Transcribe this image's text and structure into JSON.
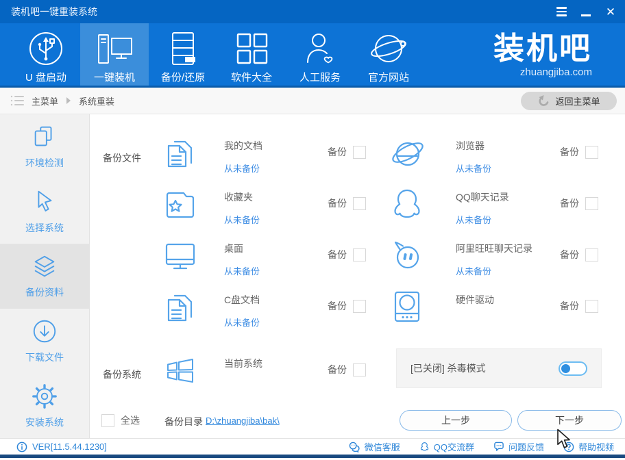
{
  "window": {
    "title": "装机吧一键重装系统"
  },
  "nav": {
    "items": [
      {
        "label": "U 盘启动"
      },
      {
        "label": "一键装机"
      },
      {
        "label": "备份/还原"
      },
      {
        "label": "软件大全"
      },
      {
        "label": "人工服务"
      },
      {
        "label": "官方网站"
      }
    ],
    "logo": {
      "text": "装机吧",
      "url": "zhuangjiba.com"
    }
  },
  "breadcrumb": {
    "root": "主菜单",
    "current": "系统重装",
    "back": "返回主菜单"
  },
  "sidebar": {
    "items": [
      {
        "label": "环境检测"
      },
      {
        "label": "选择系统"
      },
      {
        "label": "备份资料"
      },
      {
        "label": "下载文件"
      },
      {
        "label": "安装系统"
      }
    ]
  },
  "main": {
    "section_files": "备份文件",
    "section_system": "备份系统",
    "backup_label": "备份",
    "items": [
      {
        "title": "我的文档",
        "status": "从未备份"
      },
      {
        "title": "浏览器",
        "status": "从未备份"
      },
      {
        "title": "收藏夹",
        "status": "从未备份"
      },
      {
        "title": "QQ聊天记录",
        "status": "从未备份"
      },
      {
        "title": "桌面",
        "status": "从未备份"
      },
      {
        "title": "阿里旺旺聊天记录",
        "status": "从未备份"
      },
      {
        "title": "C盘文档",
        "status": "从未备份"
      },
      {
        "title": "硬件驱动",
        "status": ""
      },
      {
        "title": "当前系统",
        "status": ""
      }
    ],
    "antivirus": {
      "label": "[已关闭] 杀毒模式",
      "state": "off"
    },
    "select_all": "全选",
    "backup_dir_label": "备份目录 :",
    "backup_dir": "D:\\zhuangjiba\\bak\\",
    "prev": "上一步",
    "next": "下一步"
  },
  "statusbar": {
    "version": "VER[11.5.44.1230]",
    "links": [
      "微信客服",
      "QQ交流群",
      "问题反馈",
      "帮助视频"
    ]
  },
  "colors": {
    "title_bar": "#0565c2",
    "nav_bar": "#0d73d6",
    "nav_active": "#3b8edb",
    "accent": "#4f9fe8",
    "link": "#2f87dd",
    "footer_strip": "#1a4a80"
  }
}
